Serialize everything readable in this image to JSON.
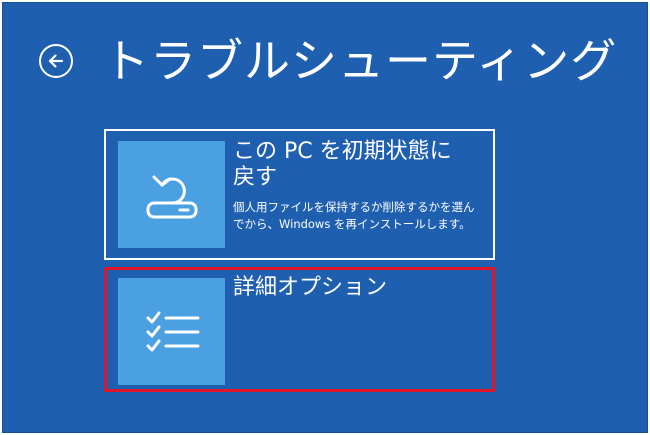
{
  "header": {
    "title": "トラブルシューティング",
    "back_icon": "back-arrow-circle-icon"
  },
  "options": [
    {
      "title_line1": "この PC を初期状態に",
      "title_line2": "戻す",
      "description": "個人用ファイルを保持するか削除するかを選んでから、Windows を再インストールします。",
      "icon": "reset-pc-icon",
      "selected": false
    },
    {
      "title_line1": "詳細オプション",
      "icon": "checklist-icon",
      "selected": true
    }
  ],
  "colors": {
    "background": "#1f5fb0",
    "tile_icon_bg": "#4aa0e0",
    "selection_border": "#e0162b",
    "focus_border": "#ffffff"
  }
}
